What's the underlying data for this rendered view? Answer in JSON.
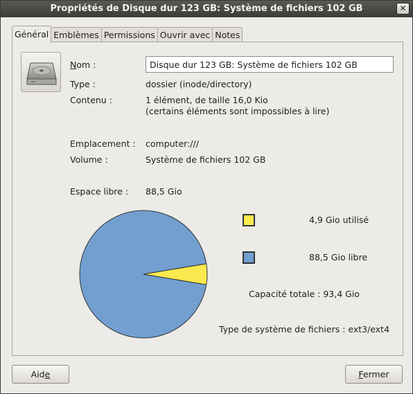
{
  "window": {
    "title": "Propriétés de Disque dur 123 GB: Système de fichiers 102 GB",
    "close_symbol": "✕"
  },
  "tabs": [
    {
      "label": "Général",
      "active": true
    },
    {
      "label": "Emblèmes",
      "active": false
    },
    {
      "label": "Permissions",
      "active": false
    },
    {
      "label": "Ouvrir avec",
      "active": false
    },
    {
      "label": "Notes",
      "active": false
    }
  ],
  "general": {
    "icon": "harddisk-icon",
    "name_label_first": "N",
    "name_label_rest": "om :",
    "name_value": "Disque dur 123 GB: Système de fichiers 102 GB",
    "type_label": "Type :",
    "type_value": "dossier (inode/directory)",
    "contents_label": "Contenu :",
    "contents_line1": "1 élément, de taille 16,0 Kio",
    "contents_line2": "(certains éléments sont impossibles à lire)",
    "location_label": "Emplacement :",
    "location_value": "computer:///",
    "volume_label": "Volume :",
    "volume_value": "Système de fichiers 102 GB",
    "free_space_label": "Espace libre :",
    "free_space_value": "88,5 Gio"
  },
  "usage": {
    "used_text": "4,9 Gio utilisé",
    "free_text": "88,5 Gio libre",
    "capacity_text": "Capacité totale : 93,4 Gio",
    "fs_type_text": "Type de système de fichiers : ext3/ext4",
    "used_gio": 4.9,
    "free_gio": 88.5,
    "used_color": "#fce94f",
    "free_color": "#729fcf",
    "outline_color": "#2e3436"
  },
  "buttons": {
    "help_pre": "Aid",
    "help_mnemonic": "e",
    "close_mnemonic": "F",
    "close_rest": "ermer"
  }
}
